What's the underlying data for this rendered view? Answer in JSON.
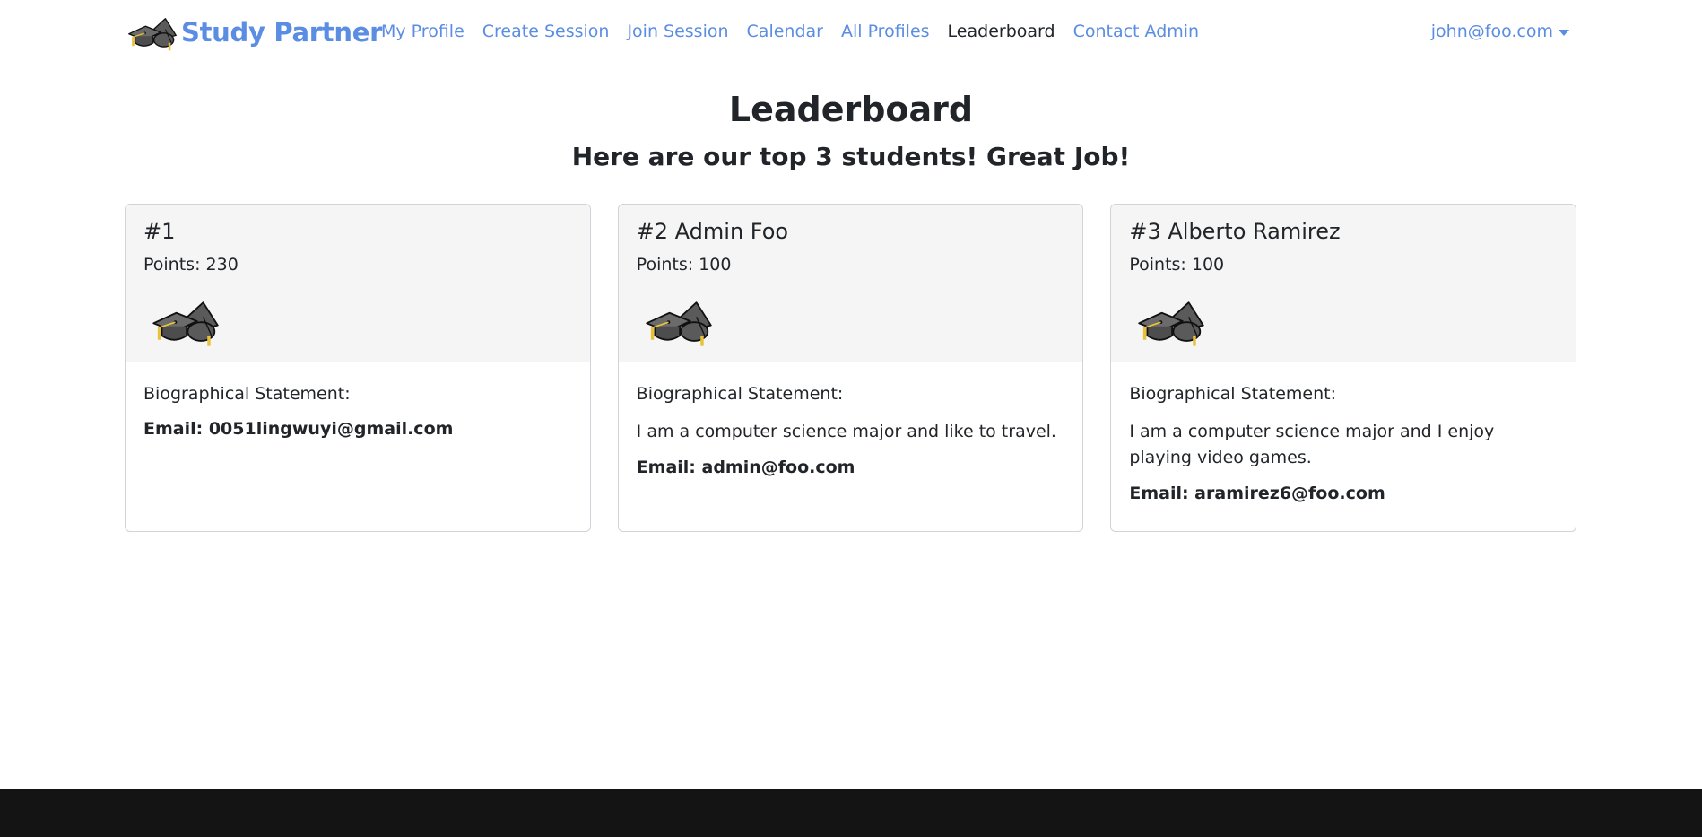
{
  "brand": {
    "name": "Study Partner",
    "logo_icon": "graduation-caps-icon",
    "color": "#5b8de3"
  },
  "nav": {
    "items": [
      {
        "label": "My Profile",
        "active": false
      },
      {
        "label": "Create Session",
        "active": false
      },
      {
        "label": "Join Session",
        "active": false
      },
      {
        "label": "Calendar",
        "active": false
      },
      {
        "label": "All Profiles",
        "active": false
      },
      {
        "label": "Leaderboard",
        "active": true
      },
      {
        "label": "Contact Admin",
        "active": false
      }
    ],
    "user": "john@foo.com"
  },
  "page": {
    "title": "Leaderboard",
    "subtitle": "Here are our top 3 students! Great Job!"
  },
  "cards": [
    {
      "rank": "#1",
      "points": "Points: 230",
      "bio_label": "Biographical Statement:",
      "bio": "",
      "email": "Email: 0051lingwuyi@gmail.com",
      "icon": "graduation-caps-icon"
    },
    {
      "rank": "#2 Admin Foo",
      "points": "Points: 100",
      "bio_label": "Biographical Statement:",
      "bio": "I am a computer science major and like to travel.",
      "email": "Email: admin@foo.com",
      "icon": "graduation-caps-icon"
    },
    {
      "rank": "#3 Alberto Ramirez",
      "points": "Points: 100",
      "bio_label": "Biographical Statement:",
      "bio": "I am a computer science major and I enjoy playing video games.",
      "email": "Email: aramirez6@foo.com",
      "icon": "graduation-caps-icon"
    }
  ],
  "colors": {
    "link": "#5b8de3",
    "footer": "#141414",
    "card_header": "#f5f5f5"
  }
}
